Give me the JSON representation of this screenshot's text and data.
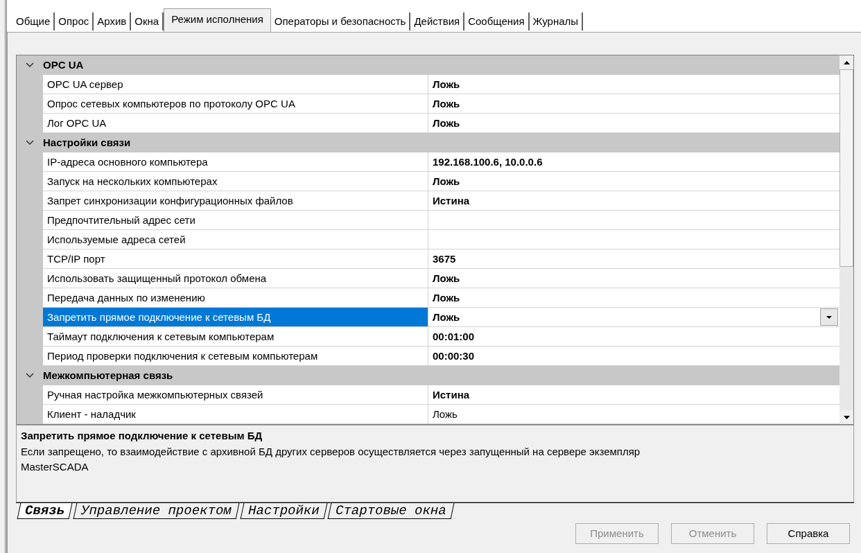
{
  "tabs": [
    {
      "label": "Общие",
      "selected": false
    },
    {
      "label": "Опрос",
      "selected": false
    },
    {
      "label": "Архив",
      "selected": false
    },
    {
      "label": "Окна",
      "selected": false
    },
    {
      "label": "Режим исполнения",
      "selected": true
    },
    {
      "label": "Операторы и безопасность",
      "selected": false
    },
    {
      "label": "Действия",
      "selected": false
    },
    {
      "label": "Сообщения",
      "selected": false
    },
    {
      "label": "Журналы",
      "selected": false
    }
  ],
  "grid": {
    "groups": [
      {
        "title": "OPC UA",
        "expanded": true,
        "properties": [
          {
            "name": "OPC UA сервер",
            "value": "Ложь",
            "bold": true,
            "selected": false
          },
          {
            "name": "Опрос сетевых компьютеров по протоколу OPC UA",
            "value": "Ложь",
            "bold": true,
            "selected": false
          },
          {
            "name": "Лог OPC UA",
            "value": "Ложь",
            "bold": true,
            "selected": false
          }
        ]
      },
      {
        "title": "Настройки связи",
        "expanded": true,
        "properties": [
          {
            "name": "IP-адреса основного компьютера",
            "value": "192.168.100.6, 10.0.0.6",
            "bold": true,
            "selected": false
          },
          {
            "name": "Запуск на нескольких компьютерах",
            "value": "Ложь",
            "bold": true,
            "selected": false
          },
          {
            "name": "Запрет синхронизации конфигурационных файлов",
            "value": "Истина",
            "bold": true,
            "selected": false
          },
          {
            "name": "Предпочтительный адрес сети",
            "selected": false
          },
          {
            "name": "Используемые адреса сетей",
            "selected": false
          },
          {
            "name": "TCP/IP порт",
            "value": "3675",
            "bold": true,
            "selected": false
          },
          {
            "name": "Использовать защищенный протокол обмена",
            "value": "Ложь",
            "bold": true,
            "selected": false
          },
          {
            "name": "Передача данных по изменению",
            "value": "Ложь",
            "bold": true,
            "selected": false
          },
          {
            "name": "Запретить прямое подключение к сетевым БД",
            "value": "Ложь",
            "bold": true,
            "selected": true
          },
          {
            "name": "Таймаут подключения к сетевым компьютерам",
            "value": "00:01:00",
            "bold": true,
            "selected": false
          },
          {
            "name": "Период проверки подключения к сетевым компьютерам",
            "value": "00:00:30",
            "bold": true,
            "selected": false
          }
        ]
      },
      {
        "title": "Межкомпьютерная связь",
        "expanded": true,
        "properties": [
          {
            "name": "Ручная настройка межкомпьютерных связей",
            "value": "Истина",
            "bold": true,
            "selected": false
          },
          {
            "name": "Клиент - наладчик",
            "value": "Ложь",
            "bold": false,
            "selected": false
          }
        ]
      }
    ]
  },
  "description": {
    "title": "Запретить прямое подключение к сетевым БД",
    "text": "Если запрещено, то взаимодействие с архивной БД других серверов осуществляется через запущенный на сервере экземпляр MasterSCADA"
  },
  "sheet_tabs": [
    {
      "label": "Связь",
      "selected": true
    },
    {
      "label": "Управление проектом",
      "selected": false
    },
    {
      "label": "Настройки",
      "selected": false
    },
    {
      "label": "Стартовые окна",
      "selected": false
    }
  ],
  "buttons": [
    {
      "label": "Применить",
      "disabled": true
    },
    {
      "label": "Отменить",
      "disabled": true
    },
    {
      "label": "Справка",
      "disabled": false
    }
  ]
}
